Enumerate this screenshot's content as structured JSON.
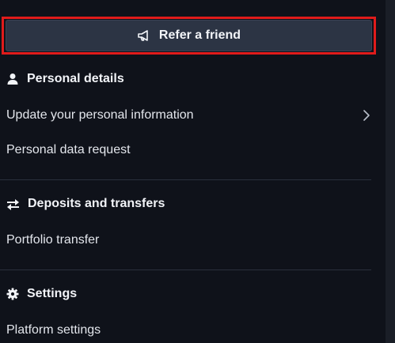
{
  "refer": {
    "label": "Refer a friend",
    "icon": "megaphone-icon"
  },
  "sections": [
    {
      "title": "Personal details",
      "icon": "person-icon",
      "items": [
        {
          "label": "Update your personal information",
          "has_chevron": true
        },
        {
          "label": "Personal data request"
        }
      ]
    },
    {
      "title": "Deposits and transfers",
      "icon": "transfer-arrows-icon",
      "items": [
        {
          "label": "Portfolio transfer"
        }
      ]
    },
    {
      "title": "Settings",
      "icon": "gear-icon",
      "items": [
        {
          "label": "Platform settings"
        }
      ]
    }
  ],
  "colors": {
    "background": "#0f121a",
    "button": "#2c3444",
    "highlight_outline": "#e01b1b"
  }
}
